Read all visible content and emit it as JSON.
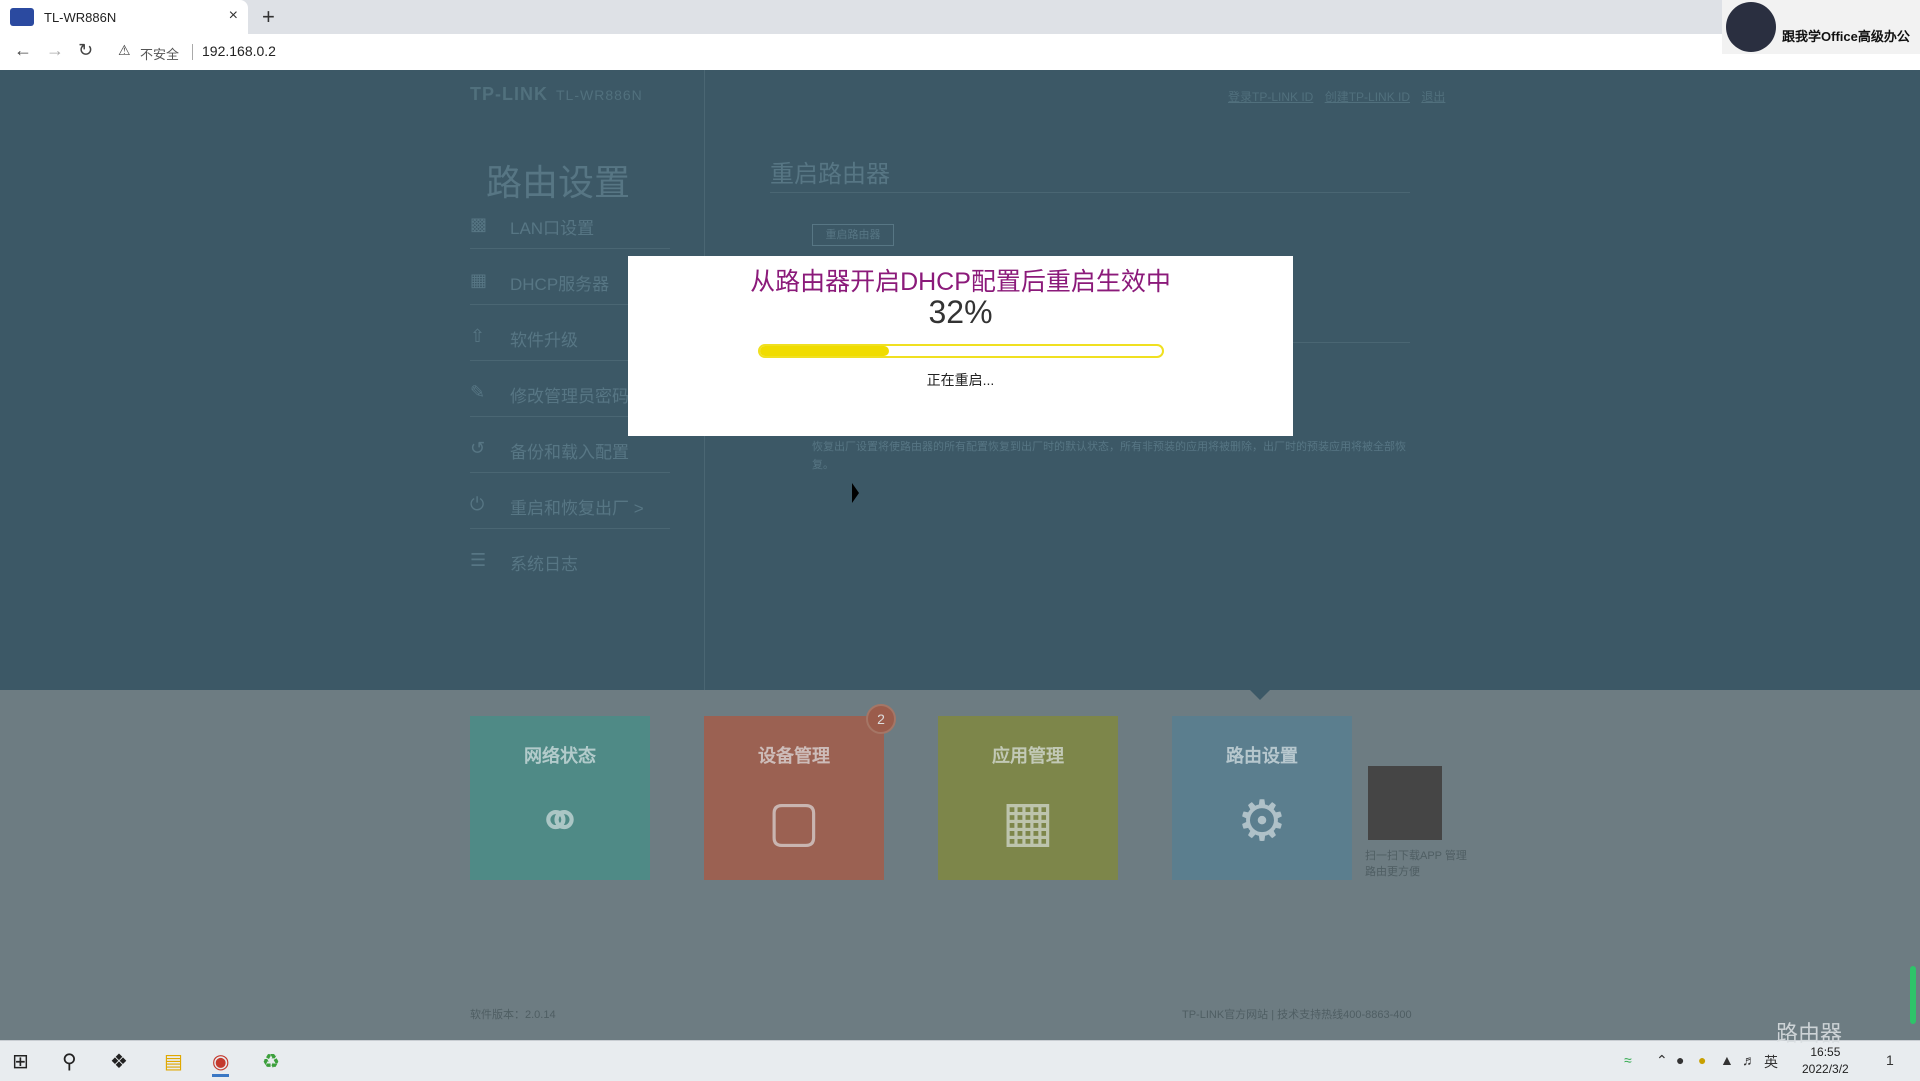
{
  "browser": {
    "tab_title": "TL-WR886N",
    "new_tab": "+",
    "tab_close": "×",
    "security_label": "不安全",
    "url": "192.168.0.2",
    "webcam_caption": "跟我学Office高级办公"
  },
  "router": {
    "brand": "TP-LINK",
    "model": "TL-WR886N",
    "top_links": [
      "登录TP-LINK ID",
      "创建TP-LINK ID",
      "退出"
    ],
    "sidebar_title": "路由设置",
    "sidebar_items": [
      {
        "label": "LAN口设置",
        "icon": "lan-icon"
      },
      {
        "label": "DHCP服务器",
        "icon": "dhcp-icon"
      },
      {
        "label": "软件升级",
        "icon": "upgrade-icon"
      },
      {
        "label": "修改管理员密码",
        "icon": "pencil-icon"
      },
      {
        "label": "备份和载入配置",
        "icon": "history-icon"
      },
      {
        "label": "重启和恢复出厂 >",
        "icon": "power-icon"
      },
      {
        "label": "系统日志",
        "icon": "list-icon"
      }
    ],
    "section_title": "重启路由器",
    "reboot_button": "重启路由器",
    "reset_description": "恢复出厂设置将使路由器的所有配置恢复到出厂时的默认状态，所有非预装的应用将被删除，出厂时的预装应用将被全部恢复。",
    "tiles": [
      {
        "label": "网络状态",
        "icon": "globe-icon",
        "color": "#4f8a86"
      },
      {
        "label": "设备管理",
        "icon": "laptop-icon",
        "color": "#9b6152"
      },
      {
        "label": "应用管理",
        "icon": "apps-icon",
        "color": "#7d864a"
      },
      {
        "label": "路由设置",
        "icon": "gear-icon",
        "color": "#5b7e8e"
      }
    ],
    "device_badge": "2",
    "qr_caption": "扫一扫下载APP 管理路由更方便",
    "footer_version": "软件版本：2.0.14",
    "footer_links": "TP-LINK官方网站 | 技术支持热线400-8863-400"
  },
  "modal": {
    "title": "从路由器开启DHCP配置后重启生效中",
    "percent_text": "32%",
    "progress": 0.32,
    "status": "正在重启..."
  },
  "taskbar": {
    "time": "16:55",
    "date": "2022/3/2",
    "ime": "英",
    "notifications": "1"
  },
  "watermark": "路由器"
}
